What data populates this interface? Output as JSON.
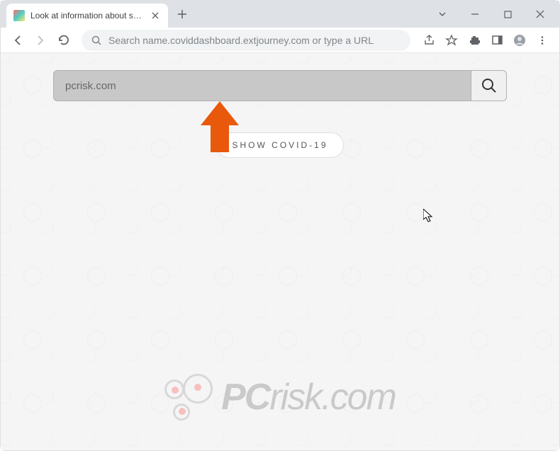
{
  "tab": {
    "title": "Look at information about spread"
  },
  "omnibox": {
    "placeholder": "Search name.coviddashboard.extjourney.com or type a URL"
  },
  "page": {
    "search_value": "pcrisk.com",
    "button_label": "SHOW COVID-19"
  },
  "watermark": {
    "brand_pc": "PC",
    "brand_risk": "risk",
    "tld": ".com"
  }
}
